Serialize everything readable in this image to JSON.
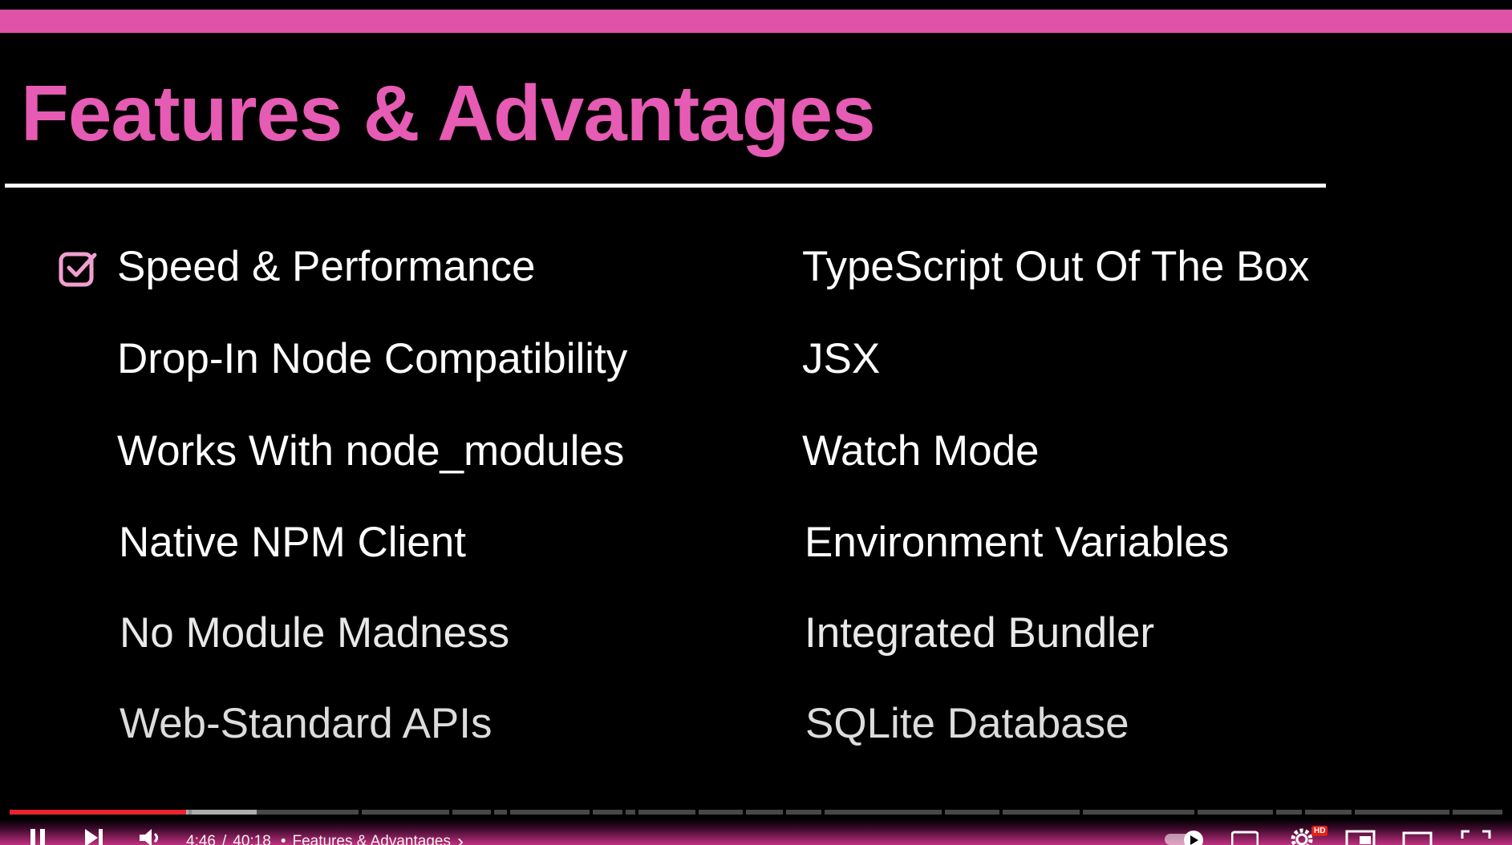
{
  "slide": {
    "title": "Features & Advantages",
    "left_features": [
      {
        "label": "Speed & Performance",
        "checked": true
      },
      {
        "label": "Drop-In Node Compatibility",
        "checked": false
      },
      {
        "label": "Works With node_modules",
        "checked": false
      },
      {
        "label": "Native NPM Client",
        "checked": false
      },
      {
        "label": "No Module Madness",
        "checked": false
      },
      {
        "label": "Web-Standard APIs",
        "checked": false
      }
    ],
    "right_features": [
      {
        "label": "TypeScript Out Of The Box"
      },
      {
        "label": "JSX"
      },
      {
        "label": "Watch Mode"
      },
      {
        "label": "Environment Variables"
      },
      {
        "label": "Integrated Bundler"
      },
      {
        "label": "SQLite Database"
      }
    ],
    "colors": {
      "accent": "#e65bb3",
      "band": "#e052a8",
      "text": "#ffffff",
      "background": "#000000"
    }
  },
  "player": {
    "current_time": "4:46",
    "duration": "40:18",
    "time_separator": "/",
    "chapter_bullet": "•",
    "chapter_title": "Features & Advantages",
    "chapter_chevron": "›",
    "hd_badge": "HD",
    "progress_fraction": 0.1184,
    "buffered_fraction": 0.1656,
    "icons": [
      "pause-icon",
      "next-icon",
      "volume-icon",
      "autoplay-toggle-icon",
      "captions-icon",
      "settings-gear-icon",
      "miniplayer-icon",
      "theater-mode-icon",
      "fullscreen-icon"
    ],
    "colors": {
      "played": "#e6242e"
    }
  }
}
